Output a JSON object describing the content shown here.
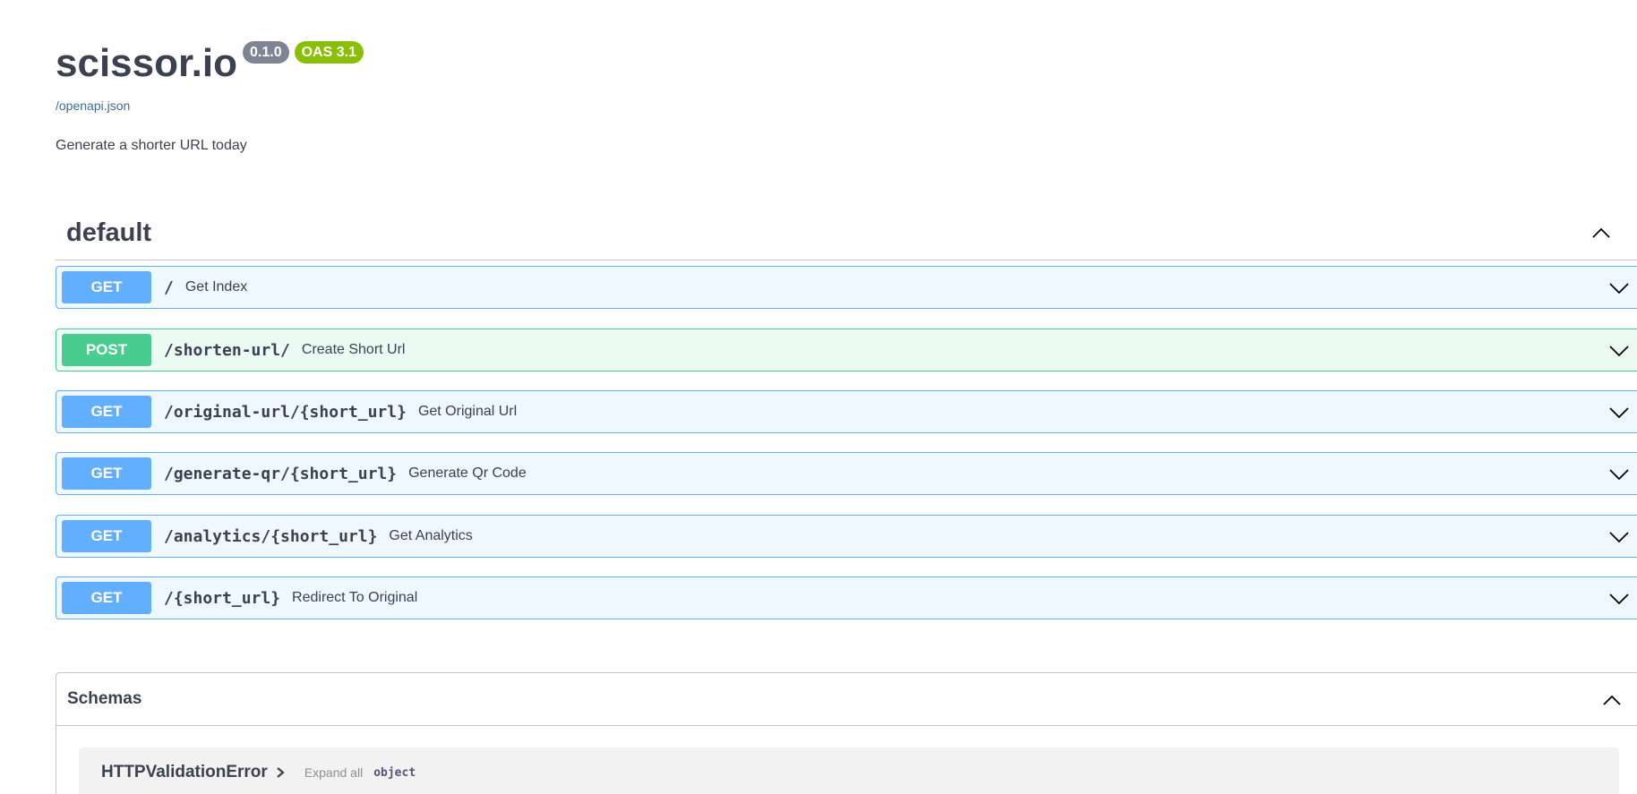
{
  "info": {
    "title": "scissor.io",
    "version": "0.1.0",
    "oas_version": "OAS 3.1",
    "spec_link": "/openapi.json",
    "description": "Generate a shorter URL today"
  },
  "tag": {
    "name": "default",
    "expanded": true
  },
  "operations": [
    {
      "method": "GET",
      "path": "/",
      "summary": "Get Index"
    },
    {
      "method": "POST",
      "path": "/shorten-url/",
      "summary": "Create Short Url"
    },
    {
      "method": "GET",
      "path": "/original-url/{short_url}",
      "summary": "Get Original Url"
    },
    {
      "method": "GET",
      "path": "/generate-qr/{short_url}",
      "summary": "Generate Qr Code"
    },
    {
      "method": "GET",
      "path": "/analytics/{short_url}",
      "summary": "Get Analytics"
    },
    {
      "method": "GET",
      "path": "/{short_url}",
      "summary": "Redirect To Original"
    }
  ],
  "schemas": {
    "title": "Schemas",
    "models": [
      {
        "name": "HTTPValidationError",
        "expand_label": "Expand all",
        "type": "object"
      }
    ]
  },
  "colors": {
    "get": "#61affe",
    "post": "#49cc90",
    "version_badge": "#7d8492",
    "oas_badge": "#89bf04",
    "text": "#3b4151"
  }
}
